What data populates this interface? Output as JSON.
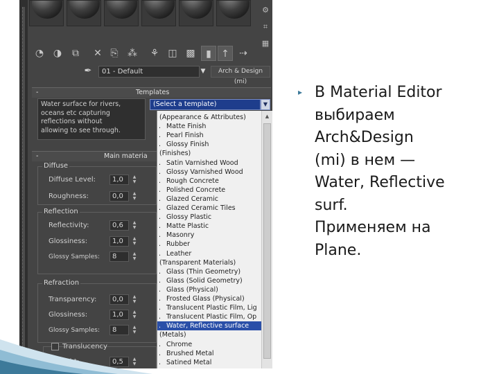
{
  "material_editor": {
    "current_material": "01 - Default",
    "material_type": "Arch & Design (mi)",
    "templates": {
      "header": "Templates",
      "description": [
        "Water surface for rivers,",
        "oceans etc capturing",
        "reflections without",
        "allowing to see through."
      ],
      "select_value": "(Select a template)",
      "options": [
        {
          "label": "(Appearance & Attributes)",
          "sub": false
        },
        {
          "label": "Matte Finish",
          "sub": true
        },
        {
          "label": "Pearl Finish",
          "sub": true
        },
        {
          "label": "Glossy Finish",
          "sub": true
        },
        {
          "label": "(Finishes)",
          "sub": false
        },
        {
          "label": "Satin Varnished Wood",
          "sub": true
        },
        {
          "label": "Glossy Varnished Wood",
          "sub": true
        },
        {
          "label": "Rough Concrete",
          "sub": true
        },
        {
          "label": "Polished Concrete",
          "sub": true
        },
        {
          "label": "Glazed Ceramic",
          "sub": true
        },
        {
          "label": "Glazed Ceramic Tiles",
          "sub": true
        },
        {
          "label": "Glossy Plastic",
          "sub": true
        },
        {
          "label": "Matte Plastic",
          "sub": true
        },
        {
          "label": "Masonry",
          "sub": true
        },
        {
          "label": "Rubber",
          "sub": true
        },
        {
          "label": "Leather",
          "sub": true
        },
        {
          "label": "(Transparent Materials)",
          "sub": false
        },
        {
          "label": "Glass (Thin Geometry)",
          "sub": true
        },
        {
          "label": "Glass (Solid Geometry)",
          "sub": true
        },
        {
          "label": "Glass (Physical)",
          "sub": true
        },
        {
          "label": "Frosted Glass (Physical)",
          "sub": true
        },
        {
          "label": "Translucent Plastic Film, Lig",
          "sub": true
        },
        {
          "label": "Translucent Plastic Film, Op",
          "sub": true
        },
        {
          "label": "Water, Reflective surface",
          "sub": true,
          "selected": true
        },
        {
          "label": "(Metals)",
          "sub": false
        },
        {
          "label": "Chrome",
          "sub": true
        },
        {
          "label": "Brushed Metal",
          "sub": true
        },
        {
          "label": "Satined Metal",
          "sub": true
        }
      ]
    },
    "main_parameters": {
      "header": "Main materia",
      "diffuse": {
        "title": "Diffuse",
        "diffuse_level_label": "Diffuse Level:",
        "diffuse_level": "1,0",
        "roughness_label": "Roughness:",
        "roughness": "0,0"
      },
      "reflection": {
        "title": "Reflection",
        "reflectivity_label": "Reflectivity:",
        "reflectivity": "0,6",
        "glossiness_label": "Glossiness:",
        "glossiness": "1,0",
        "glossy_samples_label": "Glossy Samples:",
        "glossy_samples": "8"
      },
      "refraction": {
        "title": "Refraction",
        "transparency_label": "Transparency:",
        "transparency": "0,0",
        "glossiness_label": "Glossiness:",
        "glossiness": "1,0",
        "glossy_samples_label": "Glossy Samples:",
        "glossy_samples": "8"
      },
      "translucency": {
        "label": "Translucency",
        "weight_label": "Weight:",
        "weight": "0,5"
      }
    }
  },
  "slide": {
    "bullet_symbol": "▸",
    "lines": [
      "В Material Editor",
      "выбираем",
      "Arch&Design",
      "(mi) в нем —",
      "Water, Reflective",
      "surf.",
      "Применяем на",
      "Plane."
    ]
  },
  "colors": {
    "selection": "#2a4fa8",
    "panel_bg": "#444444",
    "accent": "#3d7a9a"
  }
}
